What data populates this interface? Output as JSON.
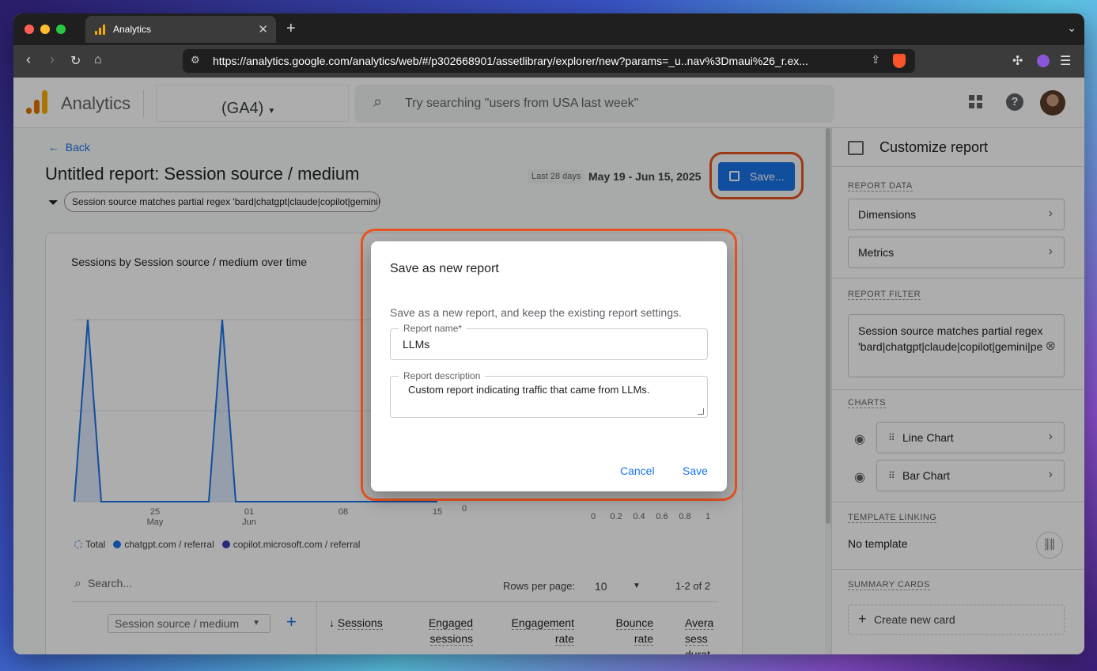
{
  "browser": {
    "tab_title": "Analytics",
    "url": "https://analytics.google.com/analytics/web/#/p302668901/assetlibrary/explorer/new?params=_u..nav%3Dmaui%26_r.ex...",
    "traffic_colors": [
      "#ff5f57",
      "#febc2e",
      "#28c840"
    ]
  },
  "header": {
    "product": "Analytics",
    "property_suffix": "(GA4)",
    "search_placeholder": "Try searching \"users from USA last week\"",
    "help_glyph": "?"
  },
  "report": {
    "back_label": "Back",
    "title": "Untitled report: Session source / medium",
    "date_label": "Last 28 days",
    "date_range": "May 19 - Jun 15, 2025",
    "save_label": "Save...",
    "filter_chip": "Session source matches partial regex 'bard|chatgpt|claude|copilot|gemini|perplexity'"
  },
  "chart_data": {
    "type": "line",
    "title": "Sessions by Session source / medium over time",
    "x_tick_labels": [
      [
        "25",
        "May"
      ],
      [
        "01",
        "Jun"
      ],
      [
        "08",
        ""
      ],
      [
        "15",
        ""
      ]
    ],
    "x_tick_index": [
      6,
      13,
      20,
      27
    ],
    "series": [
      {
        "name": "Total",
        "values": [
          0,
          1,
          0,
          0,
          0,
          0,
          0,
          0,
          0,
          0,
          0,
          1,
          0,
          0,
          0,
          0,
          0,
          0,
          0,
          0,
          0,
          0,
          0,
          0,
          0,
          0,
          0,
          0
        ],
        "color": "#1a73e8"
      }
    ],
    "legend": [
      {
        "name": "Total",
        "color": "#4285f4",
        "style": "dashed"
      },
      {
        "name": "chatgpt.com / referral",
        "color": "#1a73e8",
        "style": "solid"
      },
      {
        "name": "copilot.microsoft.com / referral",
        "color": "#3f3fb5",
        "style": "solid"
      }
    ],
    "bar_axis_ticks": [
      "0",
      "0.2",
      "0.4",
      "0.6",
      "0.8",
      "1"
    ],
    "bar_zero_label": "0",
    "grid": true
  },
  "table": {
    "search_placeholder": "Search...",
    "rows_per_page_label": "Rows per page:",
    "rows_per_page": "10",
    "pager": "1-2 of 2",
    "dimension": "Session source / medium",
    "columns": [
      {
        "line1": "Sessions",
        "line2": "",
        "sorted": true
      },
      {
        "line1": "Engaged",
        "line2": "sessions",
        "line3": ""
      },
      {
        "line1": "Engagement",
        "line2": "rate",
        "line3": ""
      },
      {
        "line1": "Bounce",
        "line2": "rate",
        "line3": ""
      },
      {
        "line1": "Avera",
        "line2": "sess",
        "line3": "durat"
      }
    ]
  },
  "sidebar": {
    "title": "Customize report",
    "report_data_label": "REPORT DATA",
    "dimensions_label": "Dimensions",
    "metrics_label": "Metrics",
    "report_filter_label": "REPORT FILTER",
    "filter_text": "Session source matches partial regex 'bard|chatgpt|claude|copilot|gemini|pe",
    "charts_label": "CHARTS",
    "line_chart_label": "Line Chart",
    "bar_chart_label": "Bar Chart",
    "template_linking_label": "TEMPLATE LINKING",
    "no_template": "No template",
    "summary_cards_label": "SUMMARY CARDS",
    "create_card_label": "Create new card"
  },
  "dialog": {
    "title": "Save as new report",
    "description": "Save as a new report, and keep the existing report settings.",
    "name_label": "Report name*",
    "name_value": "LLMs",
    "desc_label": "Report description",
    "desc_value": "Custom report indicating traffic that came from LLMs.",
    "cancel_label": "Cancel",
    "save_label": "Save"
  },
  "colors": {
    "accent": "#1a73e8",
    "highlight_ring": "#e8541f"
  }
}
